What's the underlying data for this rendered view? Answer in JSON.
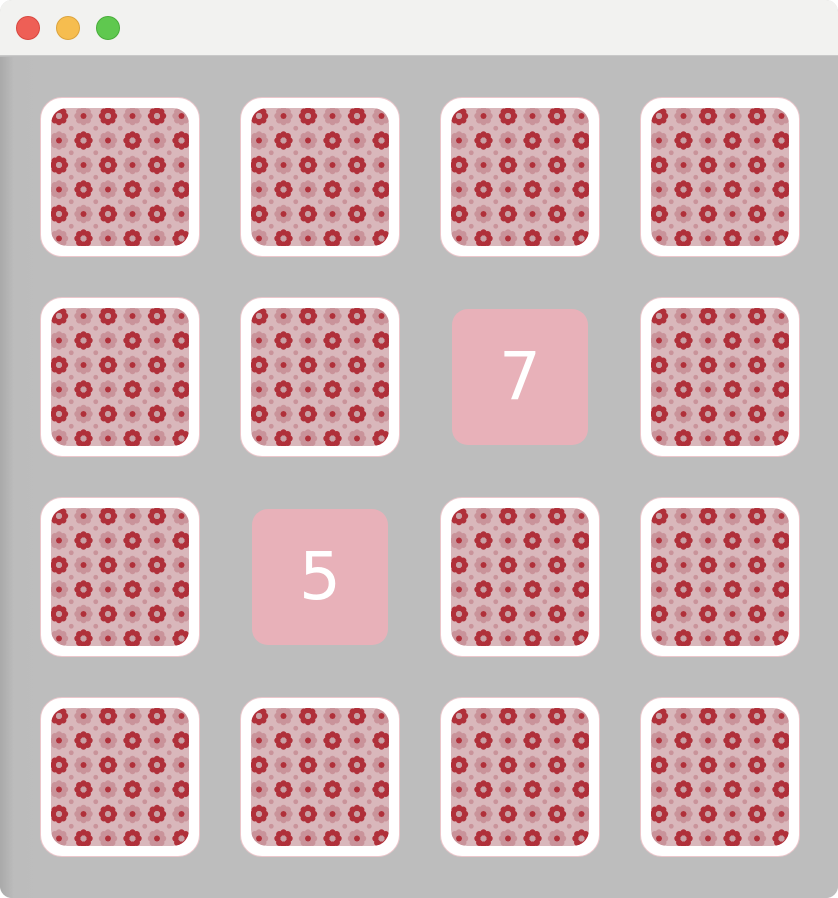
{
  "window": {
    "controls": [
      "close",
      "minimize",
      "zoom"
    ]
  },
  "colors": {
    "board_background": "#bdbdbd",
    "card_back_border": "#ecc6cb",
    "card_back_pattern_primary": "#b0303a",
    "card_back_pattern_secondary": "#c9939a",
    "card_face_background": "#e8b1b9",
    "card_face_text": "#ffffff"
  },
  "board": {
    "rows": 4,
    "columns": 4,
    "cards": [
      {
        "state": "facedown",
        "value": ""
      },
      {
        "state": "facedown",
        "value": ""
      },
      {
        "state": "facedown",
        "value": ""
      },
      {
        "state": "facedown",
        "value": ""
      },
      {
        "state": "facedown",
        "value": ""
      },
      {
        "state": "facedown",
        "value": ""
      },
      {
        "state": "faceup",
        "value": "7"
      },
      {
        "state": "facedown",
        "value": ""
      },
      {
        "state": "facedown",
        "value": ""
      },
      {
        "state": "faceup",
        "value": "5"
      },
      {
        "state": "facedown",
        "value": ""
      },
      {
        "state": "facedown",
        "value": ""
      },
      {
        "state": "facedown",
        "value": ""
      },
      {
        "state": "facedown",
        "value": ""
      },
      {
        "state": "facedown",
        "value": ""
      },
      {
        "state": "facedown",
        "value": ""
      }
    ]
  }
}
